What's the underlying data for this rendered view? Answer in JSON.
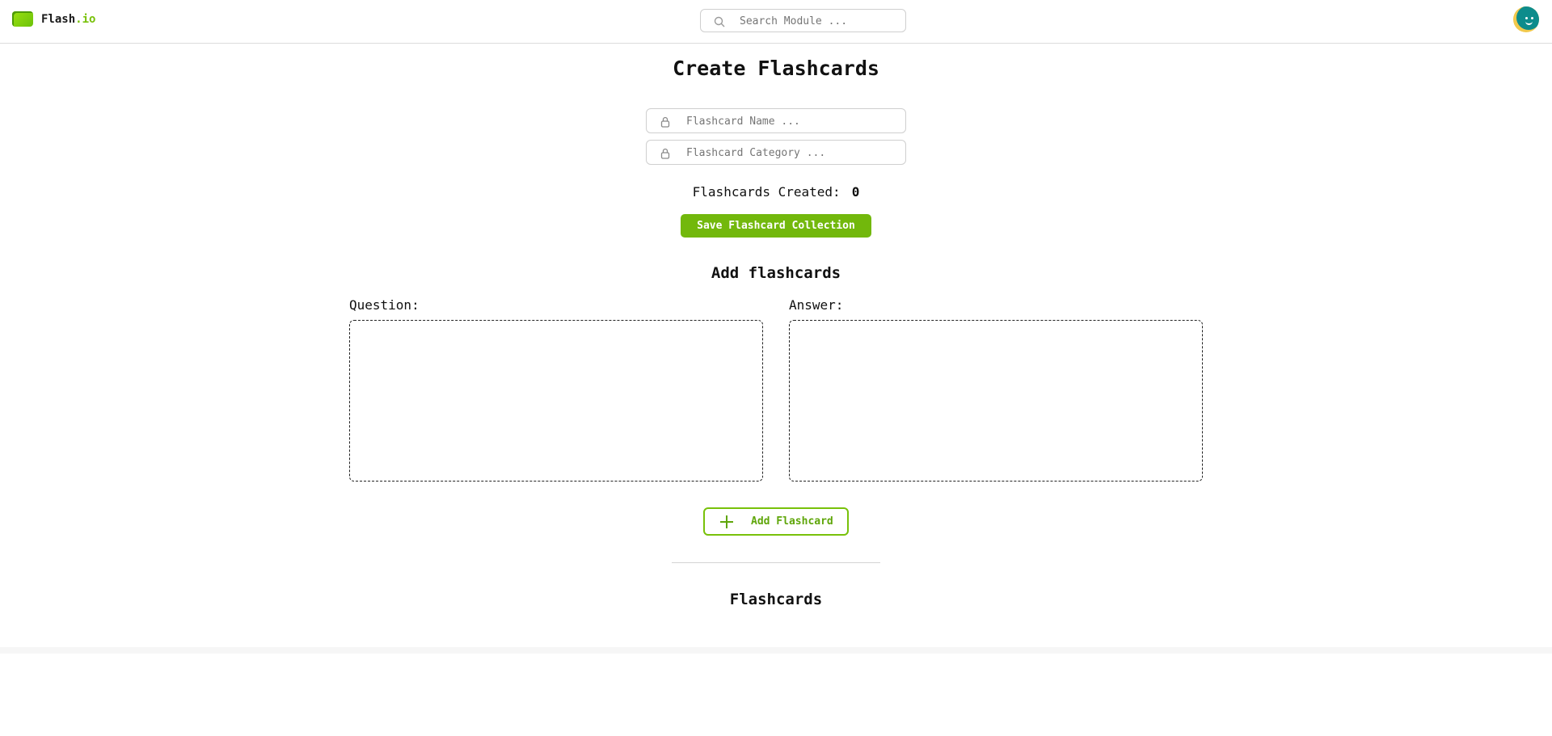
{
  "header": {
    "logo_main": "Flash",
    "logo_accent": ".io",
    "search_placeholder": "Search Module ..."
  },
  "main": {
    "title": "Create Flashcards",
    "name_placeholder": "Flashcard Name ...",
    "category_placeholder": "Flashcard Category ...",
    "created_label": "Flashcards Created:",
    "created_count": "0",
    "save_label": "Save Flashcard Collection",
    "add_section_title": "Add flashcards",
    "question_label": "Question:",
    "answer_label": "Answer:",
    "add_button_label": "Add Flashcard",
    "list_title": "Flashcards"
  },
  "colors": {
    "accent": "#78c10a",
    "save_button": "#72b80c",
    "avatar_bg": "#0d8c8c",
    "avatar_ring": "#f2c94c"
  },
  "icons": [
    "logo-icon",
    "search-icon",
    "lock-icon",
    "plus-icon",
    "avatar"
  ]
}
